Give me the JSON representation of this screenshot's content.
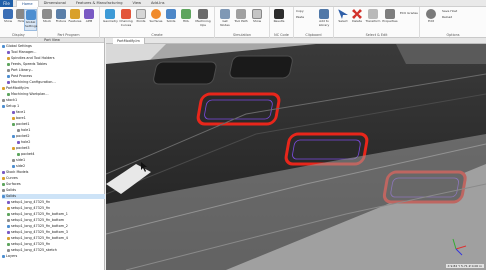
{
  "menu": {
    "file_label": "File",
    "tabs": [
      "Home",
      "Dimensional",
      "Features & Manufacturing",
      "View",
      "Add-Ins"
    ]
  },
  "ribbon": {
    "groups": {
      "display": "Display",
      "part_program": "Part Program",
      "create": "Create",
      "simulation": "Simulation",
      "nc_code": "NC Code",
      "clipboard": "Clipboard",
      "select_edit": "Select & Edit",
      "options": "Options"
    },
    "buttons": {
      "show": "Show",
      "hide": "Hide",
      "global_settings": "Global Settings",
      "stock": "Stock",
      "fixture": "Fixture",
      "features": "Features",
      "apm": "APM",
      "geometry": "Geometry",
      "chaining_curves": "Chaining Curves",
      "points": "Points",
      "surfaces": "Surfaces",
      "solids": "Solids",
      "hole": "HOL",
      "machining_ops": "Machining Ops",
      "get_nodes": "Get Nodes",
      "tool_path": "Tool Path",
      "show_sim": "Show",
      "nc_code_btn": "Results",
      "post": "Post",
      "copy": "Copy",
      "paste": "Paste",
      "add_to_library": "Add to Library",
      "select": "Select",
      "delete": "Delete",
      "transform": "Transform",
      "properties": "Properties",
      "ecu_grades": "ECU Grades",
      "edit": "Edit",
      "save_host": "Save Host",
      "reload": "Reload"
    }
  },
  "left_panel": {
    "title": "Part View",
    "tree": [
      {
        "label": "Global Settings",
        "indent": 0
      },
      {
        "label": "Tool Manager...",
        "indent": 1
      },
      {
        "label": "Spindles and Tool Holders",
        "indent": 1
      },
      {
        "label": "Feeds, Speeds Tables",
        "indent": 1
      },
      {
        "label": "Part Library...",
        "indent": 1
      },
      {
        "label": "Post Process",
        "indent": 1
      },
      {
        "label": "Machining Configuration...",
        "indent": 1
      },
      {
        "label": "PartModify.lm",
        "indent": 0
      },
      {
        "label": "Machining Workplan...",
        "indent": 1
      },
      {
        "label": "stock1",
        "indent": 0
      },
      {
        "label": "Setup 1",
        "indent": 0
      },
      {
        "label": "face1",
        "indent": 2
      },
      {
        "label": "bore1",
        "indent": 2
      },
      {
        "label": "pocket1",
        "indent": 2
      },
      {
        "label": "hole1",
        "indent": 3
      },
      {
        "label": "pocket2",
        "indent": 2
      },
      {
        "label": "hole2",
        "indent": 3
      },
      {
        "label": "pocket3",
        "indent": 2
      },
      {
        "label": "pocket4",
        "indent": 3
      },
      {
        "label": "side1",
        "indent": 2
      },
      {
        "label": "side2",
        "indent": 2
      },
      {
        "label": "Stock Models",
        "indent": 0
      },
      {
        "label": "Curves",
        "indent": 0
      },
      {
        "label": "Surfaces",
        "indent": 0
      },
      {
        "label": "Solids",
        "indent": 0
      },
      {
        "label": "Solids",
        "indent": 0,
        "selected": true
      },
      {
        "label": "setup1_long_47325_fin",
        "indent": 1
      },
      {
        "label": "setup1_long_47325_fin",
        "indent": 1
      },
      {
        "label": "setup1_long_47325_fin_bottom_1",
        "indent": 1
      },
      {
        "label": "setup1_long_47325_fin_bottom",
        "indent": 1
      },
      {
        "label": "setup1_long_47325_fin_bottom_2",
        "indent": 1
      },
      {
        "label": "setup1_long_47325_fin_bottom_3",
        "indent": 1
      },
      {
        "label": "setup1_long_47325_fin_bottom_4",
        "indent": 1
      },
      {
        "label": "setup1_long_47325_fin",
        "indent": 1
      },
      {
        "label": "setup1_long_47325_sketch",
        "indent": 1
      },
      {
        "label": "Layers",
        "indent": 0
      }
    ]
  },
  "viewport": {
    "tab_label": "PartModify.lm",
    "status": "X 9.82 Y 5.71 Z 0.00 in"
  },
  "colors": {
    "accent": "#1f5fa8",
    "toolpath_red": "#e8261b",
    "toolpath_purple": "#7b4be0",
    "part_dark": "#2b2b2b"
  }
}
